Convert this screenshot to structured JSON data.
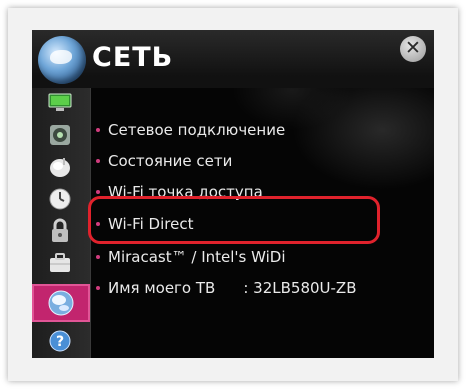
{
  "header": {
    "title": "СЕТЬ",
    "close_glyph": "✕",
    "title_icon": "network-globe-icon",
    "close_icon": "close-icon"
  },
  "sidebar": {
    "items": [
      {
        "icon": "picture-icon",
        "active": false
      },
      {
        "icon": "sound-icon",
        "active": false
      },
      {
        "icon": "channels-icon",
        "active": false
      },
      {
        "icon": "time-icon",
        "active": false
      },
      {
        "icon": "lock-icon",
        "active": false
      },
      {
        "icon": "options-icon",
        "active": false
      },
      {
        "icon": "network-icon",
        "active": true
      },
      {
        "icon": "support-icon",
        "active": false
      }
    ]
  },
  "menu": {
    "items": [
      {
        "label": "Сетевое подключение"
      },
      {
        "label": "Состояние сети"
      },
      {
        "label": "Wi-Fi точка доступа"
      },
      {
        "label": "Wi-Fi Direct",
        "highlighted": true
      },
      {
        "label": "Miracast™ / Intel's WiDi"
      },
      {
        "label": "Имя моего ТВ",
        "value": ":  32LB580U-ZB"
      }
    ]
  },
  "colors": {
    "accent": "#c2256e",
    "bullet": "#d13c7e",
    "highlight_frame": "#e0222c",
    "text": "#eaeaea"
  }
}
